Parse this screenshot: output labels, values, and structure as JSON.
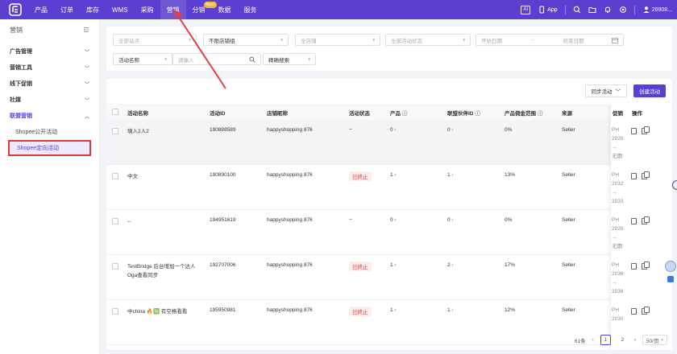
{
  "colors": {
    "brand": "#5b3fd0",
    "danger": "#d9363e",
    "annotation": "#e0404a"
  },
  "topnav": {
    "items": [
      "产品",
      "订单",
      "库存",
      "WMS",
      "采购",
      "营销",
      "分销",
      "数据",
      "服务"
    ],
    "active_index": 5,
    "badge": "New",
    "ai_label": "AI",
    "app_label": "App",
    "user_label": "26908..."
  },
  "sidebar": {
    "title": "营销",
    "groups": [
      {
        "label": "广告管理"
      },
      {
        "label": "营销工具"
      },
      {
        "label": "线下促销"
      },
      {
        "label": "社媒"
      },
      {
        "label": "联盟营销",
        "open": true
      }
    ],
    "subitems": [
      "Shopee公开活动",
      "Shopee定向活动"
    ],
    "selected_sub_index": 1
  },
  "filters": {
    "site_placeholder": "全部站点",
    "shop_status_value": "不限店铺组",
    "shop_placeholder": "全店铺",
    "activity_status_placeholder": "全部活动状态",
    "start_date_placeholder": "开始日期",
    "date_separator": "→",
    "end_date_placeholder": "结束日期",
    "field_select_value": "活动名称",
    "keyword_placeholder": "请输入",
    "search_mode_value": "精确搜索"
  },
  "toolbar": {
    "sync_label": "同步活动",
    "create_label": "创建活动"
  },
  "table": {
    "headers": {
      "name": "活动名称",
      "id": "活动ID",
      "shop": "店铺昵称",
      "status": "活动状态",
      "product": "产品",
      "partner": "联盟伙伴ID",
      "commission": "产品佣金范围",
      "source": "来源",
      "promo": "促销",
      "ops": "操作"
    },
    "rows": [
      {
        "name": "填入2人2",
        "id": "190888589",
        "shop": "happyshopping 876",
        "status": "--",
        "product": "0",
        "partner": "0",
        "commission": "0%",
        "source": "Seller",
        "promo": [
          "PH",
          "2026",
          "→",
          "无期"
        ]
      },
      {
        "name": "中文",
        "id": "190890100",
        "shop": "happyshopping 876",
        "status": "已终止",
        "product": "1",
        "partner": "1",
        "commission": "13%",
        "source": "Seller",
        "promo": [
          "PH",
          "2032",
          "→",
          "2033"
        ]
      },
      {
        "name": "--",
        "id": "194951619",
        "shop": "happyshopping 876",
        "status": "--",
        "product": "0",
        "partner": "0",
        "commission": "0%",
        "source": "Seller",
        "promo": [
          "PH",
          "2026",
          "→",
          "无期"
        ]
      },
      {
        "name": "TestBridge 后台增加一个达人Oga查看同步",
        "id": "192707006",
        "shop": "happyshopping 876",
        "status": "已终止",
        "product": "1",
        "partner": "2",
        "commission": "17%",
        "source": "Seller",
        "promo": [
          "PH",
          "2036",
          "→",
          "2038"
        ]
      },
      {
        "name": "中china 🔥🈯 有空格看看",
        "id": "195950981",
        "shop": "happyshopping 876",
        "status": "已终止",
        "product": "1",
        "partner": "1",
        "commission": "12%",
        "source": "Seller",
        "promo": [
          "PH",
          "2030"
        ]
      }
    ]
  },
  "pagination": {
    "total": "61条",
    "pages": [
      "1",
      "2"
    ],
    "current": "1",
    "page_size": "50/页"
  }
}
